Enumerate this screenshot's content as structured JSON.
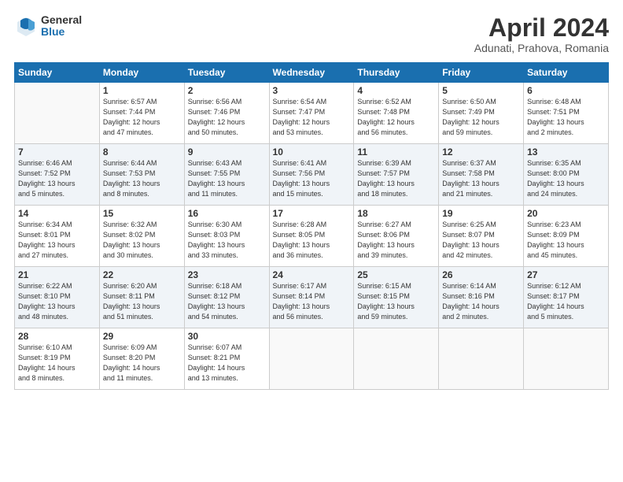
{
  "logo": {
    "general": "General",
    "blue": "Blue"
  },
  "title": "April 2024",
  "location": "Adunati, Prahova, Romania",
  "weekdays": [
    "Sunday",
    "Monday",
    "Tuesday",
    "Wednesday",
    "Thursday",
    "Friday",
    "Saturday"
  ],
  "weeks": [
    [
      {
        "day": "",
        "info": ""
      },
      {
        "day": "1",
        "info": "Sunrise: 6:57 AM\nSunset: 7:44 PM\nDaylight: 12 hours\nand 47 minutes."
      },
      {
        "day": "2",
        "info": "Sunrise: 6:56 AM\nSunset: 7:46 PM\nDaylight: 12 hours\nand 50 minutes."
      },
      {
        "day": "3",
        "info": "Sunrise: 6:54 AM\nSunset: 7:47 PM\nDaylight: 12 hours\nand 53 minutes."
      },
      {
        "day": "4",
        "info": "Sunrise: 6:52 AM\nSunset: 7:48 PM\nDaylight: 12 hours\nand 56 minutes."
      },
      {
        "day": "5",
        "info": "Sunrise: 6:50 AM\nSunset: 7:49 PM\nDaylight: 12 hours\nand 59 minutes."
      },
      {
        "day": "6",
        "info": "Sunrise: 6:48 AM\nSunset: 7:51 PM\nDaylight: 13 hours\nand 2 minutes."
      }
    ],
    [
      {
        "day": "7",
        "info": "Sunrise: 6:46 AM\nSunset: 7:52 PM\nDaylight: 13 hours\nand 5 minutes."
      },
      {
        "day": "8",
        "info": "Sunrise: 6:44 AM\nSunset: 7:53 PM\nDaylight: 13 hours\nand 8 minutes."
      },
      {
        "day": "9",
        "info": "Sunrise: 6:43 AM\nSunset: 7:55 PM\nDaylight: 13 hours\nand 11 minutes."
      },
      {
        "day": "10",
        "info": "Sunrise: 6:41 AM\nSunset: 7:56 PM\nDaylight: 13 hours\nand 15 minutes."
      },
      {
        "day": "11",
        "info": "Sunrise: 6:39 AM\nSunset: 7:57 PM\nDaylight: 13 hours\nand 18 minutes."
      },
      {
        "day": "12",
        "info": "Sunrise: 6:37 AM\nSunset: 7:58 PM\nDaylight: 13 hours\nand 21 minutes."
      },
      {
        "day": "13",
        "info": "Sunrise: 6:35 AM\nSunset: 8:00 PM\nDaylight: 13 hours\nand 24 minutes."
      }
    ],
    [
      {
        "day": "14",
        "info": "Sunrise: 6:34 AM\nSunset: 8:01 PM\nDaylight: 13 hours\nand 27 minutes."
      },
      {
        "day": "15",
        "info": "Sunrise: 6:32 AM\nSunset: 8:02 PM\nDaylight: 13 hours\nand 30 minutes."
      },
      {
        "day": "16",
        "info": "Sunrise: 6:30 AM\nSunset: 8:03 PM\nDaylight: 13 hours\nand 33 minutes."
      },
      {
        "day": "17",
        "info": "Sunrise: 6:28 AM\nSunset: 8:05 PM\nDaylight: 13 hours\nand 36 minutes."
      },
      {
        "day": "18",
        "info": "Sunrise: 6:27 AM\nSunset: 8:06 PM\nDaylight: 13 hours\nand 39 minutes."
      },
      {
        "day": "19",
        "info": "Sunrise: 6:25 AM\nSunset: 8:07 PM\nDaylight: 13 hours\nand 42 minutes."
      },
      {
        "day": "20",
        "info": "Sunrise: 6:23 AM\nSunset: 8:09 PM\nDaylight: 13 hours\nand 45 minutes."
      }
    ],
    [
      {
        "day": "21",
        "info": "Sunrise: 6:22 AM\nSunset: 8:10 PM\nDaylight: 13 hours\nand 48 minutes."
      },
      {
        "day": "22",
        "info": "Sunrise: 6:20 AM\nSunset: 8:11 PM\nDaylight: 13 hours\nand 51 minutes."
      },
      {
        "day": "23",
        "info": "Sunrise: 6:18 AM\nSunset: 8:12 PM\nDaylight: 13 hours\nand 54 minutes."
      },
      {
        "day": "24",
        "info": "Sunrise: 6:17 AM\nSunset: 8:14 PM\nDaylight: 13 hours\nand 56 minutes."
      },
      {
        "day": "25",
        "info": "Sunrise: 6:15 AM\nSunset: 8:15 PM\nDaylight: 13 hours\nand 59 minutes."
      },
      {
        "day": "26",
        "info": "Sunrise: 6:14 AM\nSunset: 8:16 PM\nDaylight: 14 hours\nand 2 minutes."
      },
      {
        "day": "27",
        "info": "Sunrise: 6:12 AM\nSunset: 8:17 PM\nDaylight: 14 hours\nand 5 minutes."
      }
    ],
    [
      {
        "day": "28",
        "info": "Sunrise: 6:10 AM\nSunset: 8:19 PM\nDaylight: 14 hours\nand 8 minutes."
      },
      {
        "day": "29",
        "info": "Sunrise: 6:09 AM\nSunset: 8:20 PM\nDaylight: 14 hours\nand 11 minutes."
      },
      {
        "day": "30",
        "info": "Sunrise: 6:07 AM\nSunset: 8:21 PM\nDaylight: 14 hours\nand 13 minutes."
      },
      {
        "day": "",
        "info": ""
      },
      {
        "day": "",
        "info": ""
      },
      {
        "day": "",
        "info": ""
      },
      {
        "day": "",
        "info": ""
      }
    ]
  ]
}
